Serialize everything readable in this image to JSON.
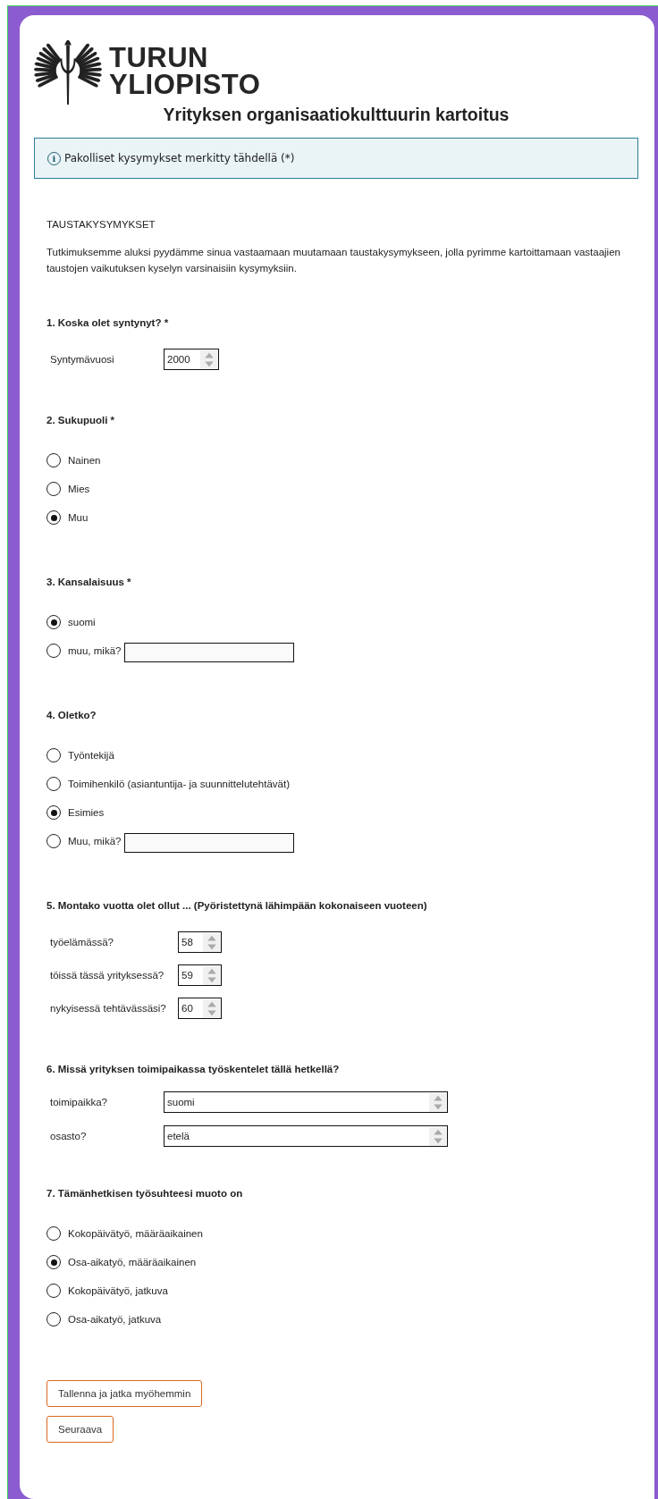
{
  "header": {
    "logo_lines": [
      "TURUN",
      "YLIOPISTO"
    ],
    "title": "Yrityksen organisaatiokulttuurin kartoitus"
  },
  "notice": {
    "icon": "i",
    "text": "Pakolliset kysymykset merkitty tähdellä (*)"
  },
  "section": {
    "title": "TAUSTAKYSYMYKSET",
    "intro": "Tutkimuksemme aluksi pyydämme sinua vastaamaan muutamaan taustakysymykseen, jolla pyrimme kartoittamaan vastaajien taustojen vaikutuksen kyselyn varsinaisiin kysymyksiin."
  },
  "questions": [
    {
      "kind": "number",
      "title": "1. Koska olet syntynyt? *",
      "fields": [
        {
          "label": "Syntymävuosi",
          "value": "2000"
        }
      ]
    },
    {
      "kind": "radio",
      "title": "2. Sukupuoli *",
      "options": [
        {
          "label": "Nainen",
          "selected": false
        },
        {
          "label": "Mies",
          "selected": false
        },
        {
          "label": "Muu",
          "selected": true
        }
      ]
    },
    {
      "kind": "radio",
      "title": "3. Kansalaisuus *",
      "options": [
        {
          "label": "suomi",
          "selected": true
        },
        {
          "label": "muu, mikä?",
          "selected": false,
          "kind": "other"
        }
      ]
    },
    {
      "kind": "radio",
      "title": "4. Oletko?",
      "options": [
        {
          "label": "Työntekijä",
          "selected": false
        },
        {
          "label": "Toimihenkilö (asiantuntija- ja suunnittelutehtävät)",
          "selected": false
        },
        {
          "label": "Esimies",
          "selected": true
        },
        {
          "label": "Muu, mikä?",
          "selected": false,
          "kind": "other"
        }
      ]
    },
    {
      "kind": "number",
      "title": "5. Montako vuotta olet ollut ...  (Pyöristettynä lähimpään kokonaiseen vuoteen)",
      "fields": [
        {
          "label": "työelämässä?",
          "value": "58"
        },
        {
          "label": "töissä tässä yrityksessä?",
          "value": "59"
        },
        {
          "label": "nykyisessä tehtävässäsi?",
          "value": "60"
        }
      ]
    },
    {
      "kind": "select",
      "title": "6. Missä yrityksen toimipaikassa työskentelet tällä hetkellä?",
      "fields": [
        {
          "label": "toimipaikka?",
          "value": "suomi"
        },
        {
          "label": "osasto?",
          "value": "etelä"
        }
      ]
    },
    {
      "kind": "radio",
      "title": "7. Tämänhetkisen työsuhteesi muoto on",
      "options": [
        {
          "label": "Kokopäivätyö, määräaikainen",
          "selected": false
        },
        {
          "label": "Osa-aikatyö, määräaikainen",
          "selected": true
        },
        {
          "label": "Kokopäivätyö, jatkuva",
          "selected": false
        },
        {
          "label": "Osa-aikatyö, jatkuva",
          "selected": false
        }
      ]
    }
  ],
  "buttons": [
    "Tallenna ja jatka myöhemmin",
    "Seuraava"
  ]
}
